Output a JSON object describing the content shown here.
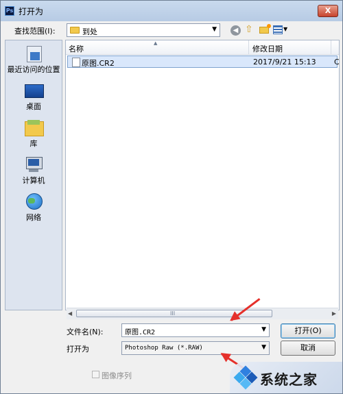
{
  "window": {
    "title": "打开为",
    "app_icon_text": "Ps",
    "close_glyph": "X"
  },
  "toolbar": {
    "look_in_label": "查找范围(I):",
    "look_in_value": "到处",
    "combo_arrow": "▼",
    "back_glyph": "◀",
    "up_glyph": "⇧",
    "views_arrow": "▼"
  },
  "places": [
    {
      "label": "最近访问的位置",
      "icon": "recent-places-icon"
    },
    {
      "label": "桌面",
      "icon": "desktop-icon"
    },
    {
      "label": "库",
      "icon": "library-icon"
    },
    {
      "label": "计算机",
      "icon": "computer-icon"
    },
    {
      "label": "网络",
      "icon": "network-icon"
    }
  ],
  "file_list": {
    "columns": [
      "名称",
      "修改日期"
    ],
    "sort_glyph": "▲",
    "rows": [
      {
        "name": "原图.CR2",
        "modified": "2017/9/21 15:13",
        "extra": "C"
      }
    ]
  },
  "scrollbar": {
    "left_glyph": "◀",
    "right_glyph": "▶",
    "grip": "III"
  },
  "form": {
    "filename_label": "文件名(N):",
    "filename_value": "原图.CR2",
    "filetype_label": "打开为",
    "filetype_value": "Photoshop Raw (*.RAW)",
    "dropdown_arrow": "▼",
    "open_button": "打开(O)",
    "cancel_button": "取消",
    "image_sequence_label": "图像序列"
  },
  "watermark": {
    "text": "系统之家"
  },
  "colors": {
    "annotation_arrow": "#e5302b",
    "selection": "#d9e7fb",
    "title_bar": "#c9daee"
  }
}
